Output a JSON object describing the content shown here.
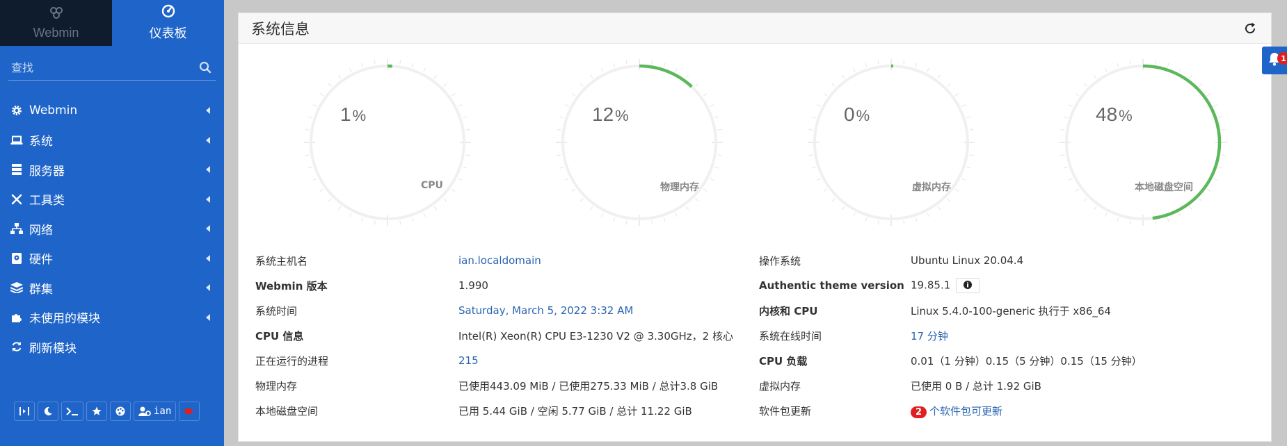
{
  "sidebar": {
    "tabs": [
      {
        "label": "Webmin",
        "icon": "webmin-logo-icon"
      },
      {
        "label": "仪表板",
        "icon": "dashboard-gauge-icon"
      }
    ],
    "search_placeholder": "查找",
    "items": [
      {
        "label": "Webmin",
        "icon": "gear-icon"
      },
      {
        "label": "系统",
        "icon": "laptop-icon"
      },
      {
        "label": "服务器",
        "icon": "server-icon"
      },
      {
        "label": "工具类",
        "icon": "tools-icon"
      },
      {
        "label": "网络",
        "icon": "network-icon"
      },
      {
        "label": "硬件",
        "icon": "hdd-icon"
      },
      {
        "label": "群集",
        "icon": "layers-icon"
      },
      {
        "label": "未使用的模块",
        "icon": "puzzle-icon"
      },
      {
        "label": "刷新模块",
        "icon": "refresh-icon"
      }
    ],
    "bottom": {
      "username": "ian"
    }
  },
  "panel": {
    "title": "系统信息"
  },
  "gauges": [
    {
      "label": "CPU",
      "value": 1,
      "unit": "%"
    },
    {
      "label": "物理内存",
      "value": 12,
      "unit": "%"
    },
    {
      "label": "虚拟内存",
      "value": 0,
      "unit": "%"
    },
    {
      "label": "本地磁盘空间",
      "value": 48,
      "unit": "%"
    }
  ],
  "info_left": [
    {
      "key": "系统主机名",
      "value": "ian.localdomain"
    },
    {
      "key": "Webmin 版本",
      "value": "1.990"
    },
    {
      "key": "系统时间",
      "value": "Saturday, March 5, 2022 3:32 AM"
    },
    {
      "key": "CPU 信息",
      "value": "Intel(R) Xeon(R) CPU E3-1230 V2 @ 3.30GHz，2 核心"
    },
    {
      "key": "正在运行的进程",
      "value": "215"
    },
    {
      "key": "物理内存",
      "value": "已使用443.09 MiB / 已使用275.33 MiB / 总计3.8 GiB"
    },
    {
      "key": "本地磁盘空间",
      "value": "已用 5.44 GiB / 空闲 5.77 GiB / 总计 11.22 GiB"
    }
  ],
  "info_right": [
    {
      "key": "操作系统",
      "value": "Ubuntu Linux 20.04.4"
    },
    {
      "key": "Authentic theme version",
      "value": "19.85.1"
    },
    {
      "key": "内核和 CPU",
      "value": "Linux 5.4.0-100-generic 执行于 x86_64"
    },
    {
      "key": "系统在线时间",
      "value": "17 分钟"
    },
    {
      "key": "CPU 负载",
      "value": "0.01（1 分钟）0.15（5 分钟）0.15（15 分钟）"
    },
    {
      "key": "虚拟内存",
      "value": "已使用 0 B / 总计 1.92 GiB"
    },
    {
      "key": "软件包更新",
      "value": "个软件包可更新",
      "badge": "2"
    }
  ],
  "notification": {
    "count": "1"
  },
  "colors": {
    "sidebar": "#1f64c8",
    "sidebar_dark": "#0f1c2e",
    "gauge_fill": "#5cb85c",
    "link": "#2a64b0",
    "badge": "#e02020"
  }
}
